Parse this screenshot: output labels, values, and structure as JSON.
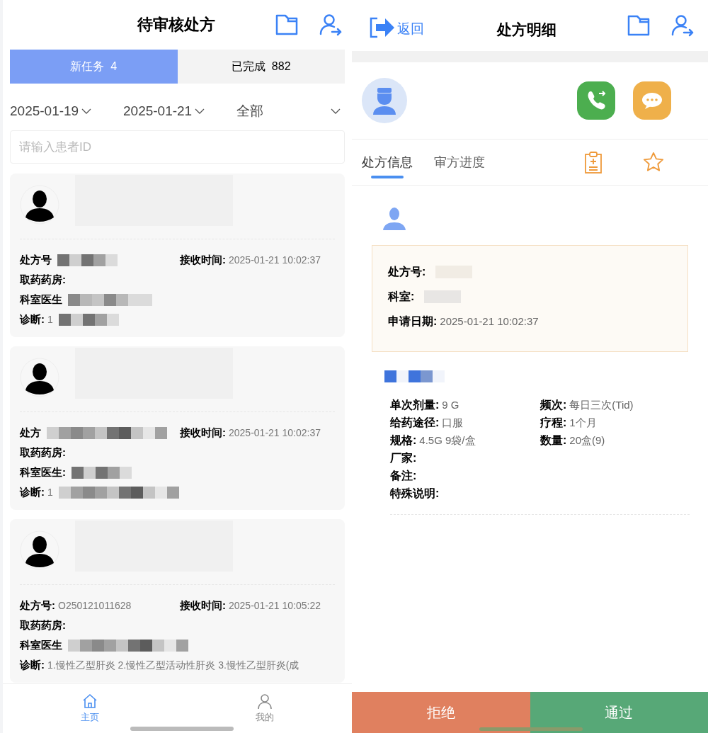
{
  "list_screen": {
    "title": "待审核处方",
    "tabs": [
      {
        "label": "新任务",
        "count": "4",
        "selected": true
      },
      {
        "label": "已完成",
        "count": "882",
        "selected": false
      }
    ],
    "filters": [
      {
        "label": "2025-01-19"
      },
      {
        "label": "2025-01-21"
      },
      {
        "label": "全部"
      }
    ],
    "search": {
      "placeholder": "请输入患者ID"
    },
    "cards": [
      {
        "rows": [
          {
            "label": "处方号",
            "redacted": true,
            "right_label": "接收时间:",
            "right_value": "2025-01-21 10:02:37"
          },
          {
            "label": "取药药房:"
          },
          {
            "label": "科室医生",
            "redacted": true
          },
          {
            "label": "诊断:",
            "value": "1",
            "redacted": true
          }
        ]
      },
      {
        "rows": [
          {
            "label": "处方",
            "redacted": true,
            "right_label": "接收时间:",
            "right_value": "2025-01-21 10:02:37"
          },
          {
            "label": "取药药房:"
          },
          {
            "label": "科室医生:",
            "redacted": true
          },
          {
            "label": "诊断:",
            "value": "1",
            "redacted": true
          }
        ]
      },
      {
        "rows": [
          {
            "label": "处方号:",
            "value": "O250121011628",
            "right_label": "接收时间:",
            "right_value": "2025-01-21 10:05:22"
          },
          {
            "label": "取药药房:"
          },
          {
            "label": "科室医生",
            "redacted": true
          },
          {
            "label": "诊断:",
            "value": "1.慢性乙型肝炎 2.慢性乙型活动性肝炎 3.慢性乙型肝炎(成"
          }
        ]
      }
    ],
    "nav": [
      {
        "label": "主页",
        "selected": true
      },
      {
        "label": "我的",
        "selected": false
      }
    ]
  },
  "detail_screen": {
    "back": "返回",
    "title": "处方明细",
    "tabs": [
      {
        "label": "处方信息",
        "selected": true
      },
      {
        "label": "审方进度",
        "selected": false
      }
    ],
    "info": [
      {
        "label": "处方号:",
        "redacted": true
      },
      {
        "label": "科室:",
        "redacted": true
      },
      {
        "label": "申请日期:",
        "value": "2025-01-21 10:02:37"
      }
    ],
    "drug": {
      "redacted": true
    },
    "details": [
      {
        "label": "单次剂量:",
        "value": "9 G"
      },
      {
        "label": "频次:",
        "value": "每日三次(Tid)"
      },
      {
        "label": "给药途径:",
        "value": "口服"
      },
      {
        "label": "疗程:",
        "value": "1个月"
      },
      {
        "label": "规格:",
        "value": "4.5G 9袋/盒"
      },
      {
        "label": "数量:",
        "value": "20盒(9)"
      }
    ],
    "notes": [
      {
        "label": "厂家:"
      },
      {
        "label": "备注:"
      },
      {
        "label": "特殊说明:"
      }
    ],
    "buttons": [
      {
        "label": "拒绝",
        "kind": "reject"
      },
      {
        "label": "通过",
        "kind": "approve"
      }
    ]
  }
}
